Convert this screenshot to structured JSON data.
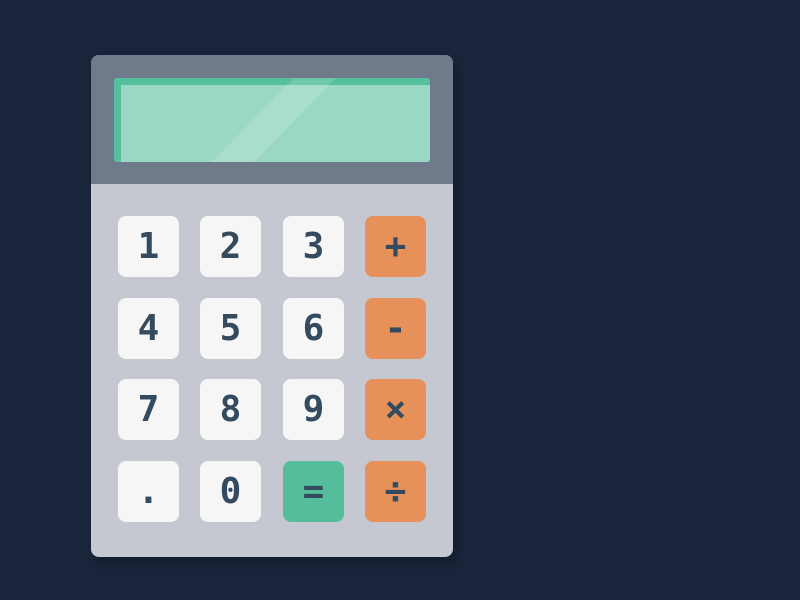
{
  "display": {
    "value": ""
  },
  "keys": [
    {
      "label": "1",
      "type": "digit"
    },
    {
      "label": "2",
      "type": "digit"
    },
    {
      "label": "3",
      "type": "digit"
    },
    {
      "label": "+",
      "type": "op"
    },
    {
      "label": "4",
      "type": "digit"
    },
    {
      "label": "5",
      "type": "digit"
    },
    {
      "label": "6",
      "type": "digit"
    },
    {
      "label": "-",
      "type": "op"
    },
    {
      "label": "7",
      "type": "digit"
    },
    {
      "label": "8",
      "type": "digit"
    },
    {
      "label": "9",
      "type": "digit"
    },
    {
      "label": "×",
      "type": "op"
    },
    {
      "label": ".",
      "type": "digit"
    },
    {
      "label": "0",
      "type": "digit"
    },
    {
      "label": "=",
      "type": "eq"
    },
    {
      "label": "÷",
      "type": "op"
    }
  ],
  "colors": {
    "background": "#1a253b",
    "operator": "#e6915a",
    "equals": "#54bd9b",
    "digit": "#f6f6f7",
    "text": "#344a5e",
    "screen": "#9bd8c4"
  }
}
